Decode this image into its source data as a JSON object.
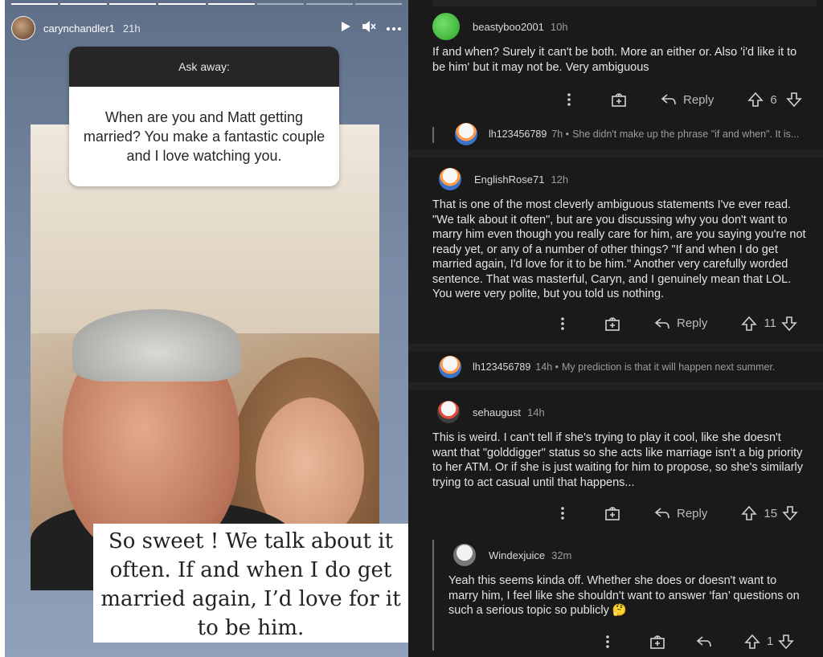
{
  "story": {
    "username": "carynchandler1",
    "time": "21h",
    "question_header": "Ask away:",
    "question_text": "When are you and Matt getting married? You make a fantastic couple and I love watching you.",
    "answer_text": "So sweet ! We talk about it often. If and when I do get married again, I’d love for it to be him."
  },
  "thread": {
    "reply_label": "Reply",
    "comments": [
      {
        "username": "beastyboo2001",
        "time": "10h",
        "body": "If and when? Surely it can't be both. More an either or. Also 'i'd like it to be him' but it may not be. Very ambiguous",
        "votes": "6"
      },
      {
        "username": "lh123456789",
        "time": "7h •",
        "preview": "She didn't make up the phrase \"if and when\". It is...",
        "collapsed": true
      },
      {
        "username": "EnglishRose71",
        "time": "12h",
        "body": "That is one of the most cleverly ambiguous statements I've ever read. \"We talk about it often\", but are you discussing why you don't want to marry him even though you really care for him, are you saying you're not ready yet, or any of a number of other things? \"If and when I do get married again, I'd love for it to be him.\" Another very carefully worded sentence. That was masterful, Caryn, and I genuinely mean that LOL. You were very polite, but you told us nothing.",
        "votes": "11"
      },
      {
        "username": "lh123456789",
        "time": "14h •",
        "preview": "My prediction is that it will happen next summer.",
        "collapsed": true
      },
      {
        "username": "sehaugust",
        "time": "14h",
        "body": "This is weird. I can't tell if she's trying to play it cool, like she doesn't want that \"golddigger\" status so she acts like marriage isn't a big priority to her ATM. Or if she is just waiting for him to propose, so she's similarly trying to act casual until that happens...",
        "votes": "15"
      },
      {
        "username": "Windexjuice",
        "time": "32m",
        "body": "Yeah this seems kinda off. Whether she does or doesn't want to marry him, I feel like she shouldn't want to answer ‘fan’ questions on such a serious topic so publicly 🤔",
        "votes": "1"
      }
    ]
  }
}
